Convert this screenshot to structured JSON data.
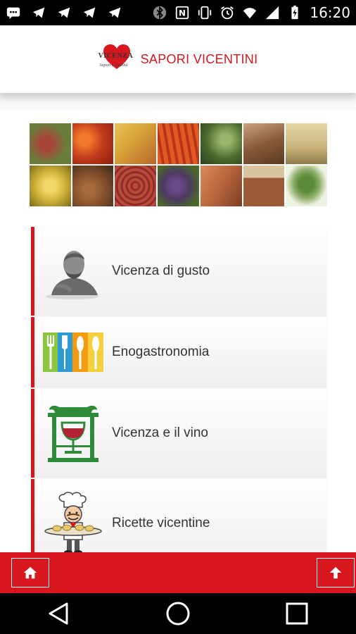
{
  "status_bar": {
    "time": "16:20",
    "left_icons": [
      "android-message-icon",
      "telegram-icon",
      "telegram-icon",
      "telegram-icon",
      "telegram-icon"
    ],
    "right_icons": [
      "bluetooth-icon",
      "nfc-icon",
      "vibrate-icon",
      "alarm-icon",
      "wifi-icon",
      "signal-icon",
      "battery-charging-icon"
    ]
  },
  "header": {
    "logo_text": "VICENZA",
    "logo_sub": "Sapori e Qualità",
    "title": "SAPORI VICENTINI"
  },
  "mosaic": {
    "tile_colors": [
      "#6b7d3b",
      "#c23a1c",
      "#d9a53a",
      "#d24a1e",
      "#4c6a2f",
      "#8a5a3a",
      "#c8b27a",
      "#d2b43b",
      "#7a4b2a",
      "#8c2d2a",
      "#4d3a5e",
      "#b7653d",
      "#9a5b36",
      "#8fae6a"
    ]
  },
  "menu": {
    "items": [
      {
        "label": "Vicenza di gusto",
        "icon": "bust-statue-icon"
      },
      {
        "label": "Enogastronomia",
        "icon": "cutlery-icon"
      },
      {
        "label": "Vicenza e il vino",
        "icon": "wine-temple-icon"
      },
      {
        "label": "Ricette vicentine",
        "icon": "chef-icon"
      }
    ]
  },
  "bottom_bar": {
    "home_icon": "home-icon",
    "up_icon": "arrow-up-icon"
  },
  "nav_bar": {
    "back_icon": "back-triangle-icon",
    "home_icon": "home-circle-icon",
    "recents_icon": "recents-square-icon"
  },
  "colors": {
    "accent": "#d7161e",
    "text": "#333333",
    "status_bg": "#000000"
  }
}
